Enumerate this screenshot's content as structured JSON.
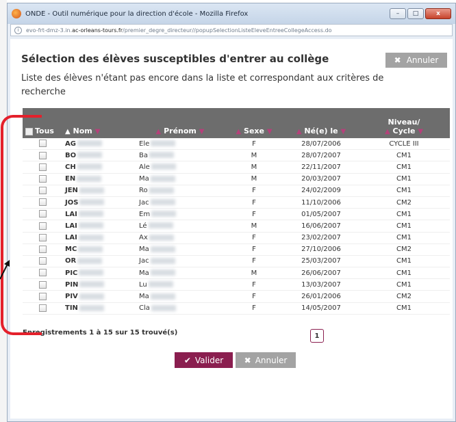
{
  "browser": {
    "title": "ONDE - Outil numérique pour la direction d'école - Mozilla Firefox",
    "url_prefix": "evo-frt-dmz-3.in.",
    "url_host": "ac-orleans-tours.fr",
    "url_path": "/premier_degre_directeur//popupSelectionListeEleveEntreeCollegeAccess.do",
    "controls": {
      "minimize": "–",
      "maximize": "□",
      "close": "x"
    }
  },
  "dialog": {
    "heading": "Sélection des élèves susceptibles d'entrer au collège",
    "subtitle": "Liste des élèves n'étant pas encore dans la liste et correspondant aux critères de recherche",
    "cancel_top": "Annuler"
  },
  "table": {
    "headers": {
      "tous": "Tous",
      "nom": "Nom",
      "prenom": "Prénom",
      "sexe": "Sexe",
      "ne_le": "Né(e) le",
      "niveau_line1": "Niveau/",
      "niveau_line2": "Cycle"
    },
    "rows": [
      {
        "nom": "AG",
        "prenom": "Ele",
        "sexe": "F",
        "date": "28/07/2006",
        "niveau": "CYCLE III"
      },
      {
        "nom": "BO",
        "prenom": "Ba",
        "sexe": "M",
        "date": "28/07/2007",
        "niveau": "CM1"
      },
      {
        "nom": "CH",
        "prenom": "Ale",
        "sexe": "M",
        "date": "22/11/2007",
        "niveau": "CM1"
      },
      {
        "nom": "EN",
        "prenom": "Ma",
        "sexe": "M",
        "date": "20/03/2007",
        "niveau": "CM1"
      },
      {
        "nom": "JEN",
        "prenom": "Ro",
        "sexe": "F",
        "date": "24/02/2009",
        "niveau": "CM1"
      },
      {
        "nom": "JOS",
        "prenom": "Jac",
        "sexe": "F",
        "date": "11/10/2006",
        "niveau": "CM2"
      },
      {
        "nom": "LAI",
        "prenom": "Em",
        "sexe": "F",
        "date": "01/05/2007",
        "niveau": "CM1"
      },
      {
        "nom": "LAI",
        "prenom": "Lé",
        "sexe": "M",
        "date": "16/06/2007",
        "niveau": "CM1"
      },
      {
        "nom": "LAI",
        "prenom": "Ax",
        "sexe": "F",
        "date": "23/02/2007",
        "niveau": "CM1"
      },
      {
        "nom": "MC",
        "prenom": "Ma",
        "sexe": "F",
        "date": "27/10/2006",
        "niveau": "CM2"
      },
      {
        "nom": "OR",
        "prenom": "Jac",
        "sexe": "F",
        "date": "25/03/2007",
        "niveau": "CM1"
      },
      {
        "nom": "PIC",
        "prenom": "Ma",
        "sexe": "M",
        "date": "26/06/2007",
        "niveau": "CM1"
      },
      {
        "nom": "PIN",
        "prenom": "Lu",
        "sexe": "F",
        "date": "13/03/2007",
        "niveau": "CM1"
      },
      {
        "nom": "PIV",
        "prenom": "Ma",
        "sexe": "F",
        "date": "26/01/2006",
        "niveau": "CM2"
      },
      {
        "nom": "TIN",
        "prenom": "Cla",
        "sexe": "F",
        "date": "14/05/2007",
        "niveau": "CM1"
      }
    ]
  },
  "footer": {
    "count": "Enregistrements 1 à 15 sur 15 trouvé(s)",
    "page": "1",
    "validate": "Valider",
    "cancel": "Annuler"
  },
  "colors": {
    "accent": "#8a1e4f",
    "header_bg": "#6d6d6d",
    "annotation": "#e4202b"
  }
}
